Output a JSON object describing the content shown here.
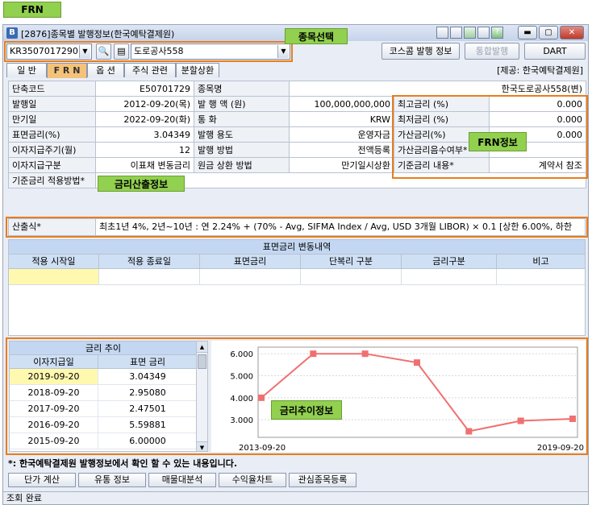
{
  "header_tag": "FRN",
  "window": {
    "title": "[2876]종목별 발행정보(한국예탁결제원)",
    "icon": "B"
  },
  "selector": {
    "code": "KR3507017290",
    "name": "도로공사558",
    "callout": "종목선택",
    "btn_koscom": "코스콤 발행 정보",
    "btn_integrated": "통합발행",
    "btn_dart": "DART"
  },
  "tabs": [
    "일 반",
    "F R N",
    "옵 션",
    "주식 관련",
    "분할상환"
  ],
  "source_note": "[제공: 한국예탁결제원]",
  "info": {
    "rows": [
      {
        "l1": "단축코드",
        "v1": "E50701729",
        "l2": "종목명",
        "v2": "한국도로공사558(변)"
      },
      {
        "l1": "발행일",
        "v1": "2012-09-20(목)",
        "l2": "발 행 액 (원)",
        "v2": "100,000,000,000"
      },
      {
        "l1": "만기일",
        "v1": "2022-09-20(화)",
        "l2": "통 화",
        "v2": "KRW"
      },
      {
        "l1": "표면금리(%)",
        "v1": "3.04349",
        "l2": "발행 용도",
        "v2": "운영자금"
      },
      {
        "l1": "이자지급주기(월)",
        "v1": "12",
        "l2": "발행 방법",
        "v2": "전액등록"
      },
      {
        "l1": "이자지급구분",
        "v1": "이표채 변동금리",
        "l2": "원금 상환 방법",
        "v2": "만기일시상환"
      },
      {
        "l1": "기준금리 적용방법*",
        "v1": "",
        "l2": "",
        "v2": ""
      }
    ],
    "frn": [
      {
        "l": "최고금리 (%)",
        "v": "0.000"
      },
      {
        "l": "최저금리 (%)",
        "v": "0.000"
      },
      {
        "l": "가산금리(%)",
        "v": "0.000"
      },
      {
        "l": "가산금리음수여부*",
        "v": ""
      },
      {
        "l": "기준금리 내용*",
        "v": "계약서 참조"
      }
    ],
    "frn_callout": "FRN정보",
    "rate_callout": "금리산출정보"
  },
  "formula": {
    "label": "산출식*",
    "text": "최초1년 4%,   2년~10년 : 연 2.24% + (70% - Avg, SIFMA Index / Avg, USD 3개월 LIBOR) × 0.1  [상한 6.00%, 하한"
  },
  "rate_change": {
    "title": "표면금리 변동내역",
    "columns": [
      "적용 시작일",
      "적용 종료일",
      "표면금리",
      "단복리 구분",
      "금리구분",
      "비고"
    ]
  },
  "trend_table": {
    "title": "금리 추이",
    "columns": [
      "이자지급일",
      "표면 금리"
    ],
    "rows": [
      {
        "date": "2019-09-20",
        "rate": "3.04349"
      },
      {
        "date": "2018-09-20",
        "rate": "2.95080"
      },
      {
        "date": "2017-09-20",
        "rate": "2.47501"
      },
      {
        "date": "2016-09-20",
        "rate": "5.59881"
      },
      {
        "date": "2015-09-20",
        "rate": "6.00000"
      }
    ]
  },
  "chart_data": {
    "type": "line",
    "x": [
      "2013-09-20",
      "2014-09-20",
      "2015-09-20",
      "2016-09-20",
      "2017-09-20",
      "2018-09-20",
      "2019-09-20"
    ],
    "values": [
      4.0,
      6.0,
      6.0,
      5.59881,
      2.47501,
      2.9508,
      3.04349
    ],
    "yticks": [
      "6.000",
      "5.000",
      "4.000",
      "3.000"
    ],
    "ylim": [
      2.2,
      6.3
    ],
    "x_start_label": "2013-09-20",
    "x_end_label": "2019-09-20",
    "line_color": "#f07070",
    "callout": "금리추이정보"
  },
  "footer_note": "*: 한국예탁결제원 발행정보에서 확인 할 수 있는 내용입니다.",
  "bottom_buttons": [
    "단가 계산",
    "유통 정보",
    "매물대분석",
    "수익율차트",
    "관심종목등록"
  ],
  "status": "조회 완료",
  "colors": {
    "accent": "#e87d1e",
    "callout": "#92d050"
  }
}
